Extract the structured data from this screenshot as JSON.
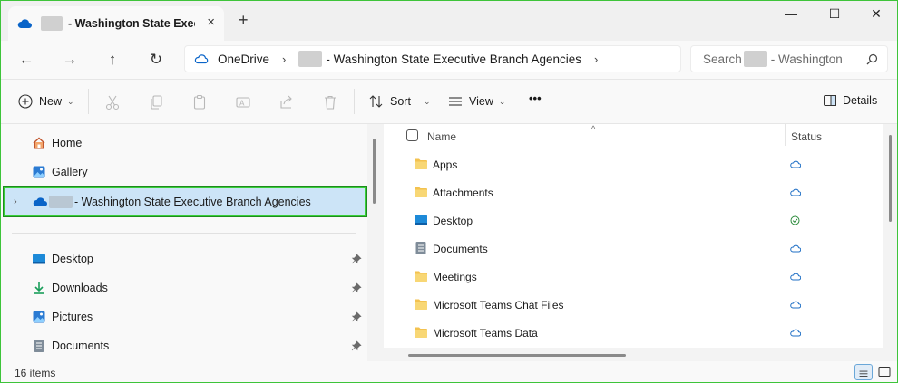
{
  "tab": {
    "title": "- Washington State Execu",
    "close_icon": "×",
    "new_tab_icon": "+"
  },
  "window_controls": {
    "minimize": "—",
    "maximize": "☐",
    "close": "✕"
  },
  "nav_buttons": {
    "back": "←",
    "forward": "→",
    "up": "↑",
    "refresh": "↻"
  },
  "address": {
    "root": "OneDrive",
    "separator": "›",
    "current": "- Washington State Executive Branch Agencies",
    "trail_chevron": "›"
  },
  "search": {
    "placeholder_prefix": "Search",
    "placeholder_suffix": "- Washington"
  },
  "toolbar": {
    "new_label": "New",
    "sort_label": "Sort",
    "view_label": "View",
    "more_label": "•••",
    "details_label": "Details",
    "chevron": "⌄"
  },
  "sidebar": {
    "items": [
      {
        "label": "Home",
        "icon": "home-icon"
      },
      {
        "label": "Gallery",
        "icon": "gallery-icon"
      },
      {
        "label": "- Washington State Executive Branch Agencies",
        "icon": "onedrive-cloud-icon",
        "selected": true
      }
    ],
    "quick_access": [
      {
        "label": "Desktop",
        "icon": "desktop-icon",
        "pinned": true
      },
      {
        "label": "Downloads",
        "icon": "downloads-icon",
        "pinned": true
      },
      {
        "label": "Pictures",
        "icon": "pictures-icon",
        "pinned": true
      },
      {
        "label": "Documents",
        "icon": "documents-icon",
        "pinned": true
      }
    ],
    "expander": "›"
  },
  "columns": {
    "name": "Name",
    "status": "Status",
    "sort_indicator": "^"
  },
  "files": [
    {
      "name": "Apps",
      "type": "folder",
      "status": "cloud"
    },
    {
      "name": "Attachments",
      "type": "folder",
      "status": "cloud"
    },
    {
      "name": "Desktop",
      "type": "desktop",
      "status": "synced"
    },
    {
      "name": "Documents",
      "type": "documents",
      "status": "cloud"
    },
    {
      "name": "Meetings",
      "type": "folder",
      "status": "cloud"
    },
    {
      "name": "Microsoft Teams Chat Files",
      "type": "folder",
      "status": "cloud"
    },
    {
      "name": "Microsoft Teams Data",
      "type": "folder",
      "status": "cloud"
    }
  ],
  "status_bar": {
    "item_count": "16 items"
  },
  "colors": {
    "accent": "#0067c0",
    "selection_bg": "#cce4f7",
    "highlight_border": "#39d039",
    "folder": "#f3c24f",
    "synced": "#2a8a3a"
  }
}
